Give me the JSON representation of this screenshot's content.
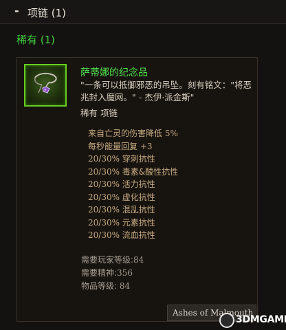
{
  "header": {
    "collapse_symbol": "-",
    "title": "项链 (1)"
  },
  "rarity_group": {
    "label": "稀有 (1)"
  },
  "item": {
    "icon": "necklace-pendant-icon",
    "name": "萨蒂娜的纪念品",
    "flavor": "\"一条可以抵御邪恶的吊坠。刻有铭文：\"将恶兆封入魔网。\" - 杰伊·派金斯\"",
    "type": "稀有 项链",
    "affixes": [
      {
        "prefix": "来自亡灵的伤害降低",
        "num": "5%",
        "suffix": ""
      },
      {
        "prefix": "每秒能量回复",
        "num": "+3",
        "suffix": ""
      },
      {
        "prefix": "",
        "num": "20/30%",
        "suffix": " 穿刺抗性"
      },
      {
        "prefix": "",
        "num": "20/30%",
        "suffix": " 毒素&酸性抗性"
      },
      {
        "prefix": "",
        "num": "20/30%",
        "suffix": " 活力抗性"
      },
      {
        "prefix": "",
        "num": "20/30%",
        "suffix": " 虚化抗性"
      },
      {
        "prefix": "",
        "num": "20/30%",
        "suffix": " 混乱抗性"
      },
      {
        "prefix": "",
        "num": "20/30%",
        "suffix": " 元素抗性"
      },
      {
        "prefix": "",
        "num": "20/30%",
        "suffix": " 流血抗性"
      }
    ],
    "requirements": [
      {
        "label": "需要玩家等级:",
        "value": "84"
      },
      {
        "label": "需要精神:",
        "value": "356"
      },
      {
        "label": "物品等级: ",
        "value": "84"
      }
    ],
    "set_button": "Ashes of Malmouth"
  },
  "watermark": {
    "text": "3DMGAME"
  },
  "colors": {
    "background": "#141210",
    "rarity_green": "#3fd13c",
    "item_name_green": "#4fe34c",
    "affix_tan": "#c9ac82",
    "requirement_gray": "#a59d92",
    "icon_border": "#66cf1e"
  }
}
